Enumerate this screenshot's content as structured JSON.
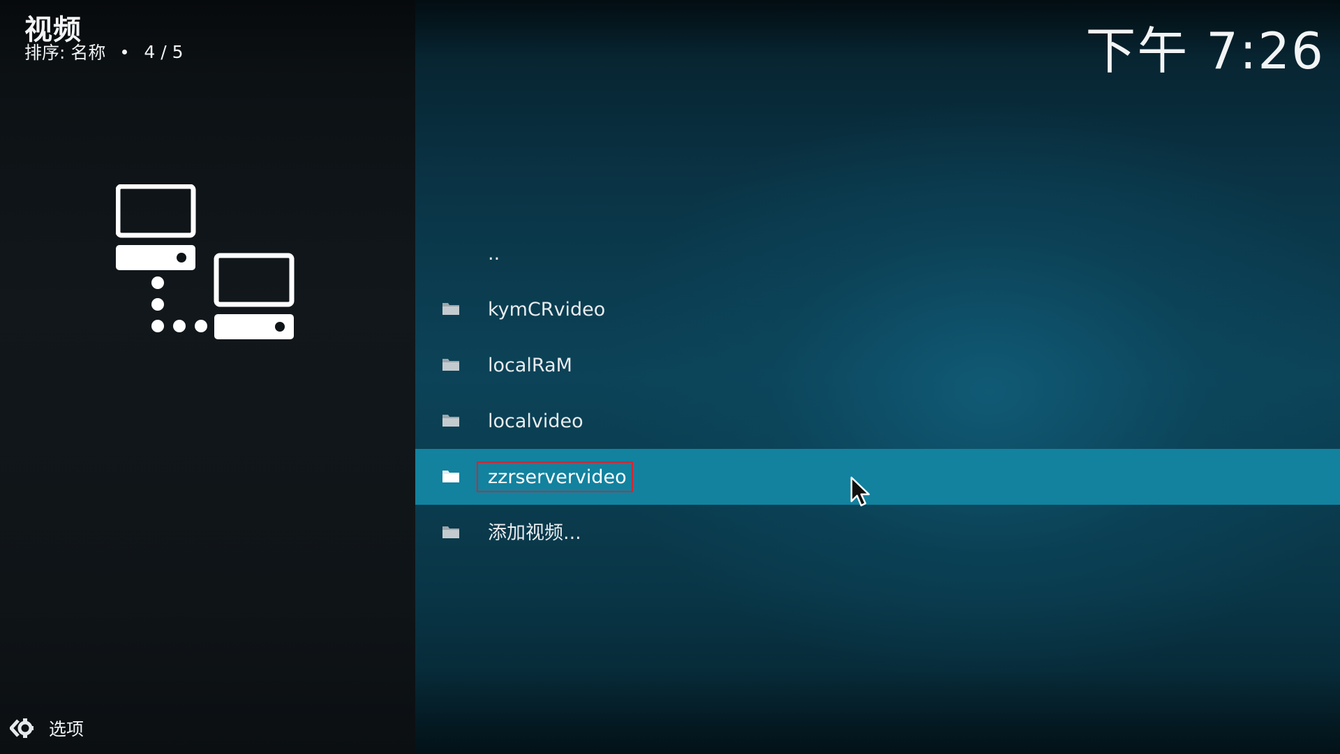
{
  "header": {
    "title": "视频",
    "sort_label": "排序: 名称",
    "position": "4 / 5"
  },
  "clock": "下午 7:26",
  "list": {
    "items": [
      {
        "label": "..",
        "icon": "none"
      },
      {
        "label": "kymCRvideo",
        "icon": "folder-icon"
      },
      {
        "label": "localRaM",
        "icon": "folder-icon"
      },
      {
        "label": "localvideo",
        "icon": "folder-icon"
      },
      {
        "label": "zzrservervideo",
        "icon": "folder-icon",
        "selected": true
      },
      {
        "label": "添加视频...",
        "icon": "folder-icon"
      }
    ]
  },
  "footer": {
    "options_label": "选项"
  },
  "colors": {
    "selection": "#12829f",
    "highlight_box": "#d9232e",
    "left_pane": "#11171b",
    "right_pane": "#0c4358"
  },
  "icons": {
    "network": "network-computers-icon",
    "options": "options-gear-icon",
    "cursor": "mouse-pointer-icon"
  }
}
